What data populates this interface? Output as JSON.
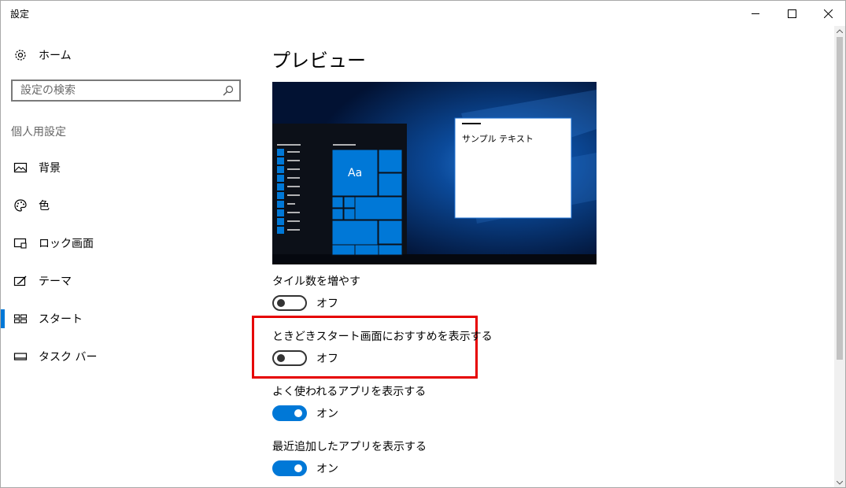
{
  "window": {
    "title": "設定"
  },
  "sidebar": {
    "home_label": "ホーム",
    "search": {
      "placeholder": "設定の検索"
    },
    "section_title": "個人用設定",
    "items": [
      {
        "label": "背景",
        "icon": "image-icon",
        "active": false
      },
      {
        "label": "色",
        "icon": "palette-icon",
        "active": false
      },
      {
        "label": "ロック画面",
        "icon": "lock-screen-icon",
        "active": false
      },
      {
        "label": "テーマ",
        "icon": "theme-icon",
        "active": false
      },
      {
        "label": "スタート",
        "icon": "start-tiles-icon",
        "active": true
      },
      {
        "label": "タスク バー",
        "icon": "taskbar-icon",
        "active": false
      }
    ]
  },
  "main": {
    "title": "プレビュー",
    "preview": {
      "sample_text": "サンプル テキスト",
      "tile_label": "Aa"
    },
    "settings": [
      {
        "label": "タイル数を増やす",
        "state": "オフ",
        "on": false
      },
      {
        "label": "ときどきスタート画面におすすめを表示する",
        "state": "オフ",
        "on": false,
        "highlighted": true
      },
      {
        "label": "よく使われるアプリを表示する",
        "state": "オン",
        "on": true
      },
      {
        "label": "最近追加したアプリを表示する",
        "state": "オン",
        "on": true
      }
    ]
  },
  "colors": {
    "accent": "#0078d7",
    "highlight": "#e60000"
  }
}
